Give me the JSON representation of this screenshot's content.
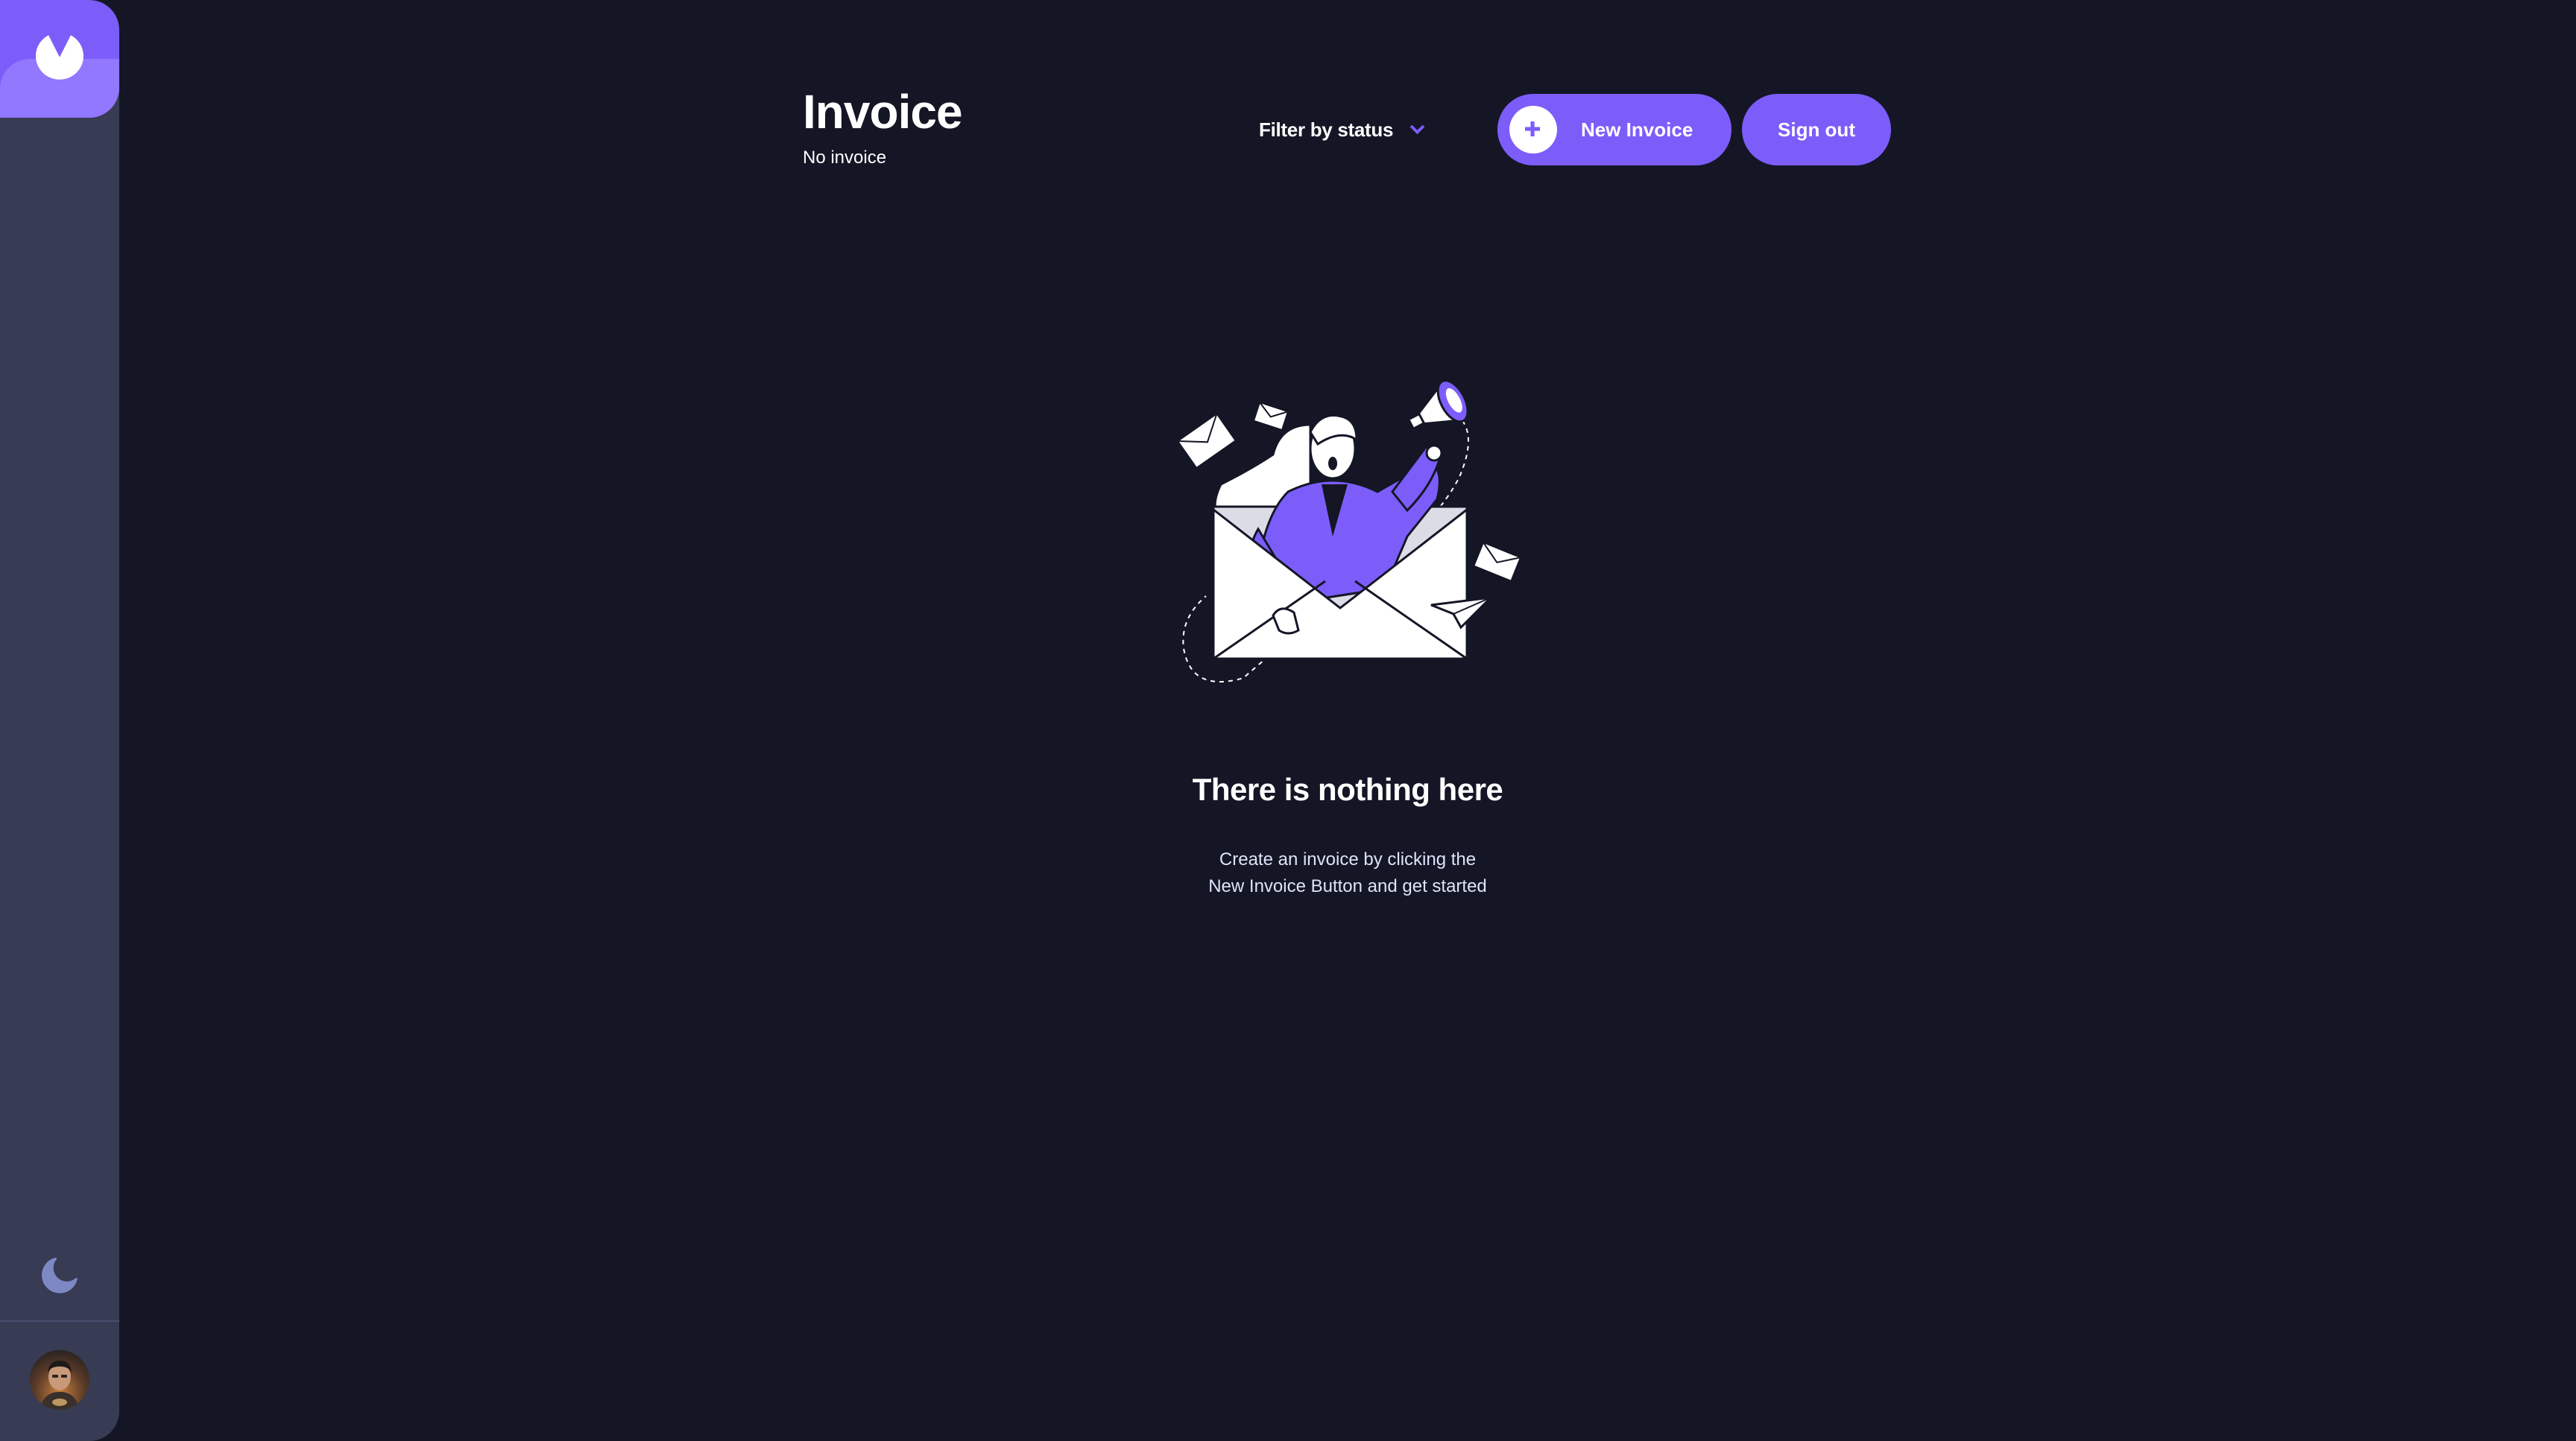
{
  "sidebar": {
    "logo_icon": "app-logo-icon",
    "theme_icon": "moon-icon",
    "avatar_icon": "user-avatar"
  },
  "header": {
    "title": "Invoice",
    "count_text": "No invoice",
    "filter_label": "Filter by status",
    "filter_icon": "chevron-down-icon",
    "new_invoice_label": "New Invoice",
    "new_invoice_icon": "plus-icon",
    "sign_out_label": "Sign out"
  },
  "empty_state": {
    "illustration": "empty-mail-illustration",
    "title": "There is nothing here",
    "description_line1": "Create an invoice by clicking the",
    "description_line2": "New Invoice Button and get started"
  },
  "colors": {
    "background": "#141625",
    "sidebar": "#373B53",
    "accent": "#7C5DFA",
    "accent_light": "#9277FF",
    "text": "#FFFFFF",
    "muted_text": "#DFE3FA"
  }
}
